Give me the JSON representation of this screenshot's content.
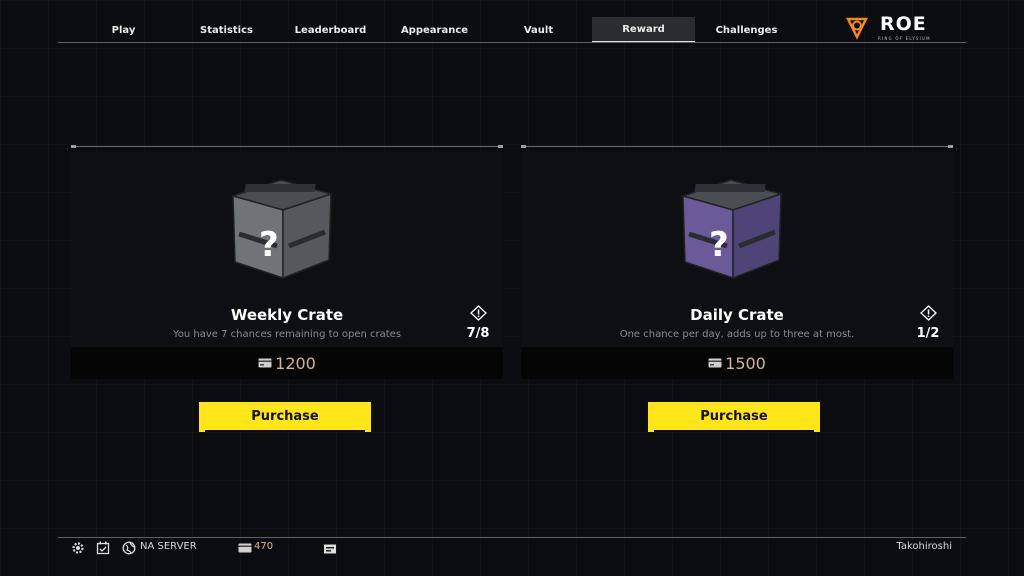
{
  "nav": {
    "tabs": [
      {
        "label": "Play"
      },
      {
        "label": "Statistics"
      },
      {
        "label": "Leaderboard"
      },
      {
        "label": "Appearance"
      },
      {
        "label": "Vault"
      },
      {
        "label": "Reward"
      },
      {
        "label": "Challenges"
      }
    ],
    "active_tab": "Reward"
  },
  "logo": {
    "word": "ROE",
    "subtitle": "RING OF ELYSIUM"
  },
  "crates": [
    {
      "title": "Weekly Crate",
      "description": "You have 7 chances remaining  to open crates",
      "count": "7/8",
      "price": "1200",
      "button": "Purchase",
      "color": "#6f7479"
    },
    {
      "title": "Daily Crate",
      "description": "One chance per day, adds up to three at most.",
      "count": "1/2",
      "price": "1500",
      "button": "Purchase",
      "color": "#6a5a9a"
    }
  ],
  "footer": {
    "server": "NA SERVER",
    "currency": "470",
    "username": "Takohiroshi"
  },
  "colors": {
    "accent": "#ffe51a",
    "price": "#d8b48a",
    "background": "#0b0c0f"
  }
}
